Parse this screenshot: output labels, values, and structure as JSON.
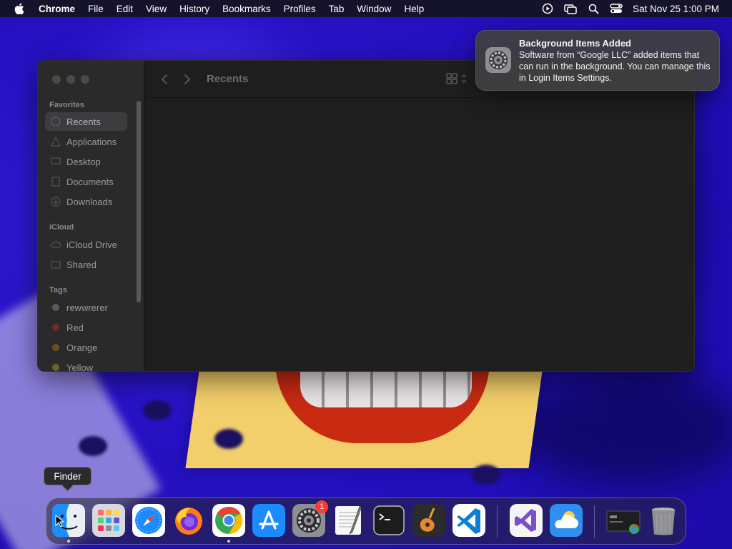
{
  "menubar": {
    "apple_icon": "apple-logo-icon",
    "app_name": "Chrome",
    "items": [
      "File",
      "Edit",
      "View",
      "History",
      "Bookmarks",
      "Profiles",
      "Tab",
      "Window",
      "Help"
    ],
    "status_icons": [
      "screen-record-icon",
      "screen-mirroring-icon",
      "spotlight-search-icon",
      "control-center-icon"
    ],
    "clock": "Sat Nov 25  1:00 PM"
  },
  "finder": {
    "title": "Recents",
    "sidebar": {
      "favorites_header": "Favorites",
      "favorites": [
        "Recents",
        "Applications",
        "Desktop",
        "Documents",
        "Downloads"
      ],
      "active_item": "Recents",
      "icloud_header": "iCloud",
      "icloud": [
        "iCloud Drive",
        "Shared"
      ],
      "tags_header": "Tags",
      "tags": [
        {
          "label": "rewwrerer",
          "color": "#6b6b6e"
        },
        {
          "label": "Red",
          "color": "#ff453a"
        },
        {
          "label": "Orange",
          "color": "#ff9f0a"
        },
        {
          "label": "Yellow",
          "color": "#ffd60a"
        }
      ]
    }
  },
  "notification": {
    "icon": "system-settings-gear-icon",
    "title": "Background Items Added",
    "body": "Software from “Google LLC” added items that can run in the background. You can manage this in Login Items Settings."
  },
  "tooltip": {
    "label": "Finder"
  },
  "dock": {
    "apps": [
      {
        "name": "Finder",
        "icon": "finder-icon",
        "running": true
      },
      {
        "name": "Launchpad",
        "icon": "launchpad-icon",
        "running": false
      },
      {
        "name": "Safari",
        "icon": "safari-icon",
        "running": false
      },
      {
        "name": "Firefox",
        "icon": "firefox-icon",
        "running": false
      },
      {
        "name": "Google Chrome",
        "icon": "chrome-icon",
        "running": true
      },
      {
        "name": "App Store",
        "icon": "app-store-icon",
        "running": false
      },
      {
        "name": "System Settings",
        "icon": "system-settings-icon",
        "running": false,
        "badge": "1"
      },
      {
        "name": "TextEdit",
        "icon": "textedit-icon",
        "running": false
      },
      {
        "name": "Terminal",
        "icon": "terminal-icon",
        "running": false
      },
      {
        "name": "GarageBand",
        "icon": "garageband-icon",
        "running": false
      },
      {
        "name": "Visual Studio Code",
        "icon": "vscode-icon",
        "running": false
      },
      {
        "name": "Visual Studio",
        "icon": "visual-studio-icon",
        "running": false
      },
      {
        "name": "Weather",
        "icon": "weather-icon",
        "running": false
      },
      {
        "name": "Chrome Minimized Window",
        "icon": "minimized-window-icon",
        "running": false
      },
      {
        "name": "Trash",
        "icon": "trash-icon",
        "running": false
      }
    ]
  }
}
